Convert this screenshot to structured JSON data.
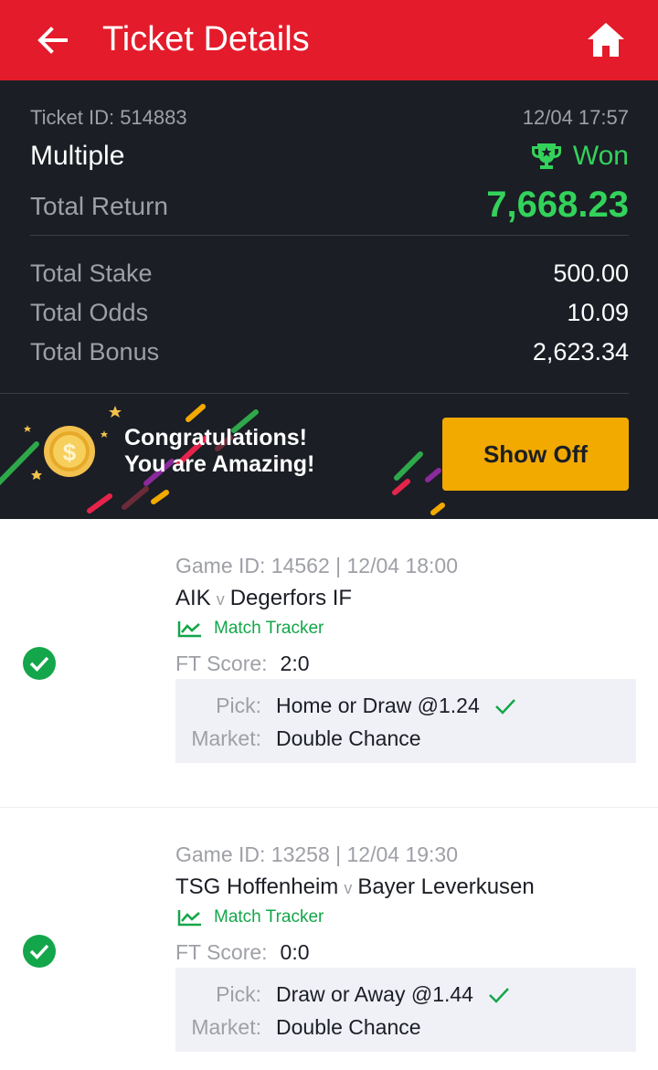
{
  "header": {
    "title": "Ticket Details",
    "back_icon": "arrow-left-icon",
    "home_icon": "home-icon"
  },
  "ticket": {
    "id_label": "Ticket ID: 514883",
    "datetime": "12/04 17:57",
    "type": "Multiple",
    "status": "Won",
    "total_return_label": "Total Return",
    "total_return": "7,668.23",
    "total_stake_label": "Total Stake",
    "total_stake": "500.00",
    "total_odds_label": "Total Odds",
    "total_odds": "10.09",
    "total_bonus_label": "Total Bonus",
    "total_bonus": "2,623.34"
  },
  "banner": {
    "line1": "Congratulations!",
    "line2": "You are Amazing!",
    "button": "Show Off"
  },
  "games": [
    {
      "meta": "Game ID: 14562 | 12/04 18:00",
      "home": "AIK",
      "vs": "v",
      "away": "Degerfors IF",
      "tracker": "Match Tracker",
      "ft_label": "FT Score:",
      "ft_score": "2:0",
      "pick_label": "Pick:",
      "pick": "Home or Draw @1.24",
      "market_label": "Market:",
      "market": "Double Chance"
    },
    {
      "meta": "Game ID: 13258 | 12/04 19:30",
      "home": "TSG Hoffenheim",
      "vs": "v",
      "away": "Bayer Leverkusen",
      "tracker": "Match Tracker",
      "ft_label": "FT Score:",
      "ft_score": "0:0",
      "pick_label": "Pick:",
      "pick": "Draw or Away @1.44",
      "market_label": "Market:",
      "market": "Double Chance"
    }
  ],
  "colors": {
    "brand_red": "#e41b2a",
    "dark_bg": "#1b1e25",
    "won_green": "#33d25b",
    "accent_yellow": "#f2a900"
  }
}
